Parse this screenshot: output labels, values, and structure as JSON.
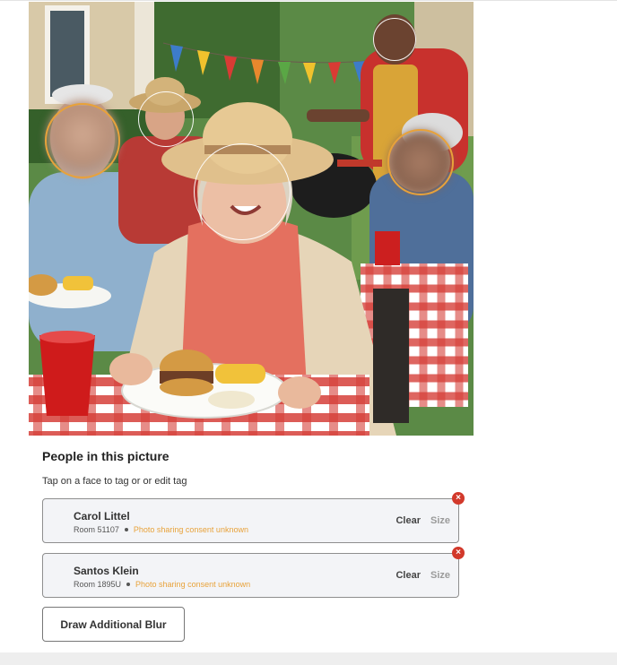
{
  "photo": {
    "alt": "Group of seniors at an outdoor barbecue picnic",
    "faces": [
      {
        "tag": "blurred",
        "style": "orange"
      },
      {
        "tag": "untagged",
        "style": "white"
      },
      {
        "tag": "untagged",
        "style": "white"
      },
      {
        "tag": "untagged",
        "style": "white"
      },
      {
        "tag": "blurred",
        "style": "orange"
      }
    ]
  },
  "people_section": {
    "title": "People in this picture",
    "hint": "Tap on a face to tag or or edit tag"
  },
  "people": [
    {
      "name": "Carol Littel",
      "room": "Room 51107",
      "consent": "Photo sharing consent unknown",
      "clear_label": "Clear",
      "size_label": "Size",
      "remove_icon": "×"
    },
    {
      "name": "Santos Klein",
      "room": "Room 1895U",
      "consent": "Photo sharing consent unknown",
      "clear_label": "Clear",
      "size_label": "Size",
      "remove_icon": "×"
    }
  ],
  "actions": {
    "draw_blur_label": "Draw Additional Blur"
  },
  "colors": {
    "consent_warning": "#e8a23a",
    "remove_red": "#d2392b",
    "card_bg": "#f3f4f7"
  }
}
